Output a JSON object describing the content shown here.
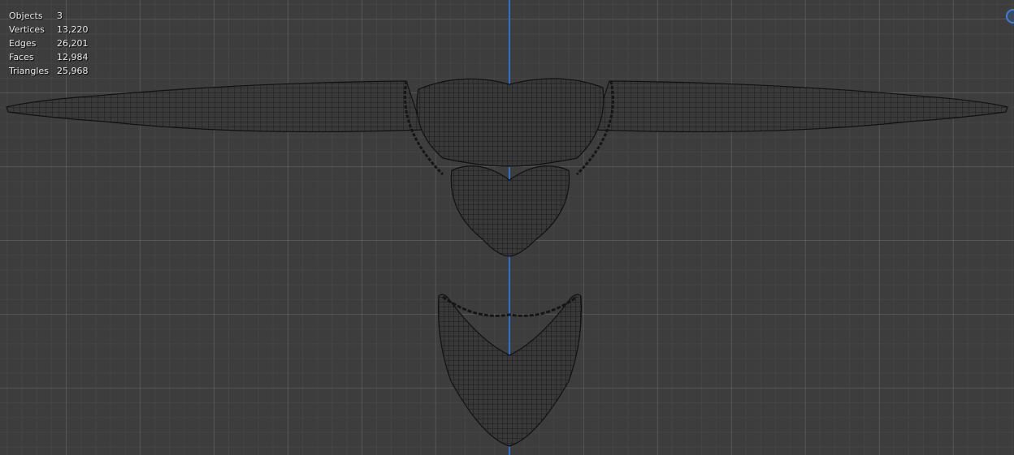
{
  "stats": [
    {
      "label": "Objects",
      "value": "3"
    },
    {
      "label": "Vertices",
      "value": "13,220"
    },
    {
      "label": "Edges",
      "value": "26,201"
    },
    {
      "label": "Faces",
      "value": "12,984"
    },
    {
      "label": "Triangles",
      "value": "25,968"
    }
  ],
  "colors": {
    "background": "#3d3d3d",
    "axis": "#2f6fd0",
    "wire": "#111111"
  }
}
